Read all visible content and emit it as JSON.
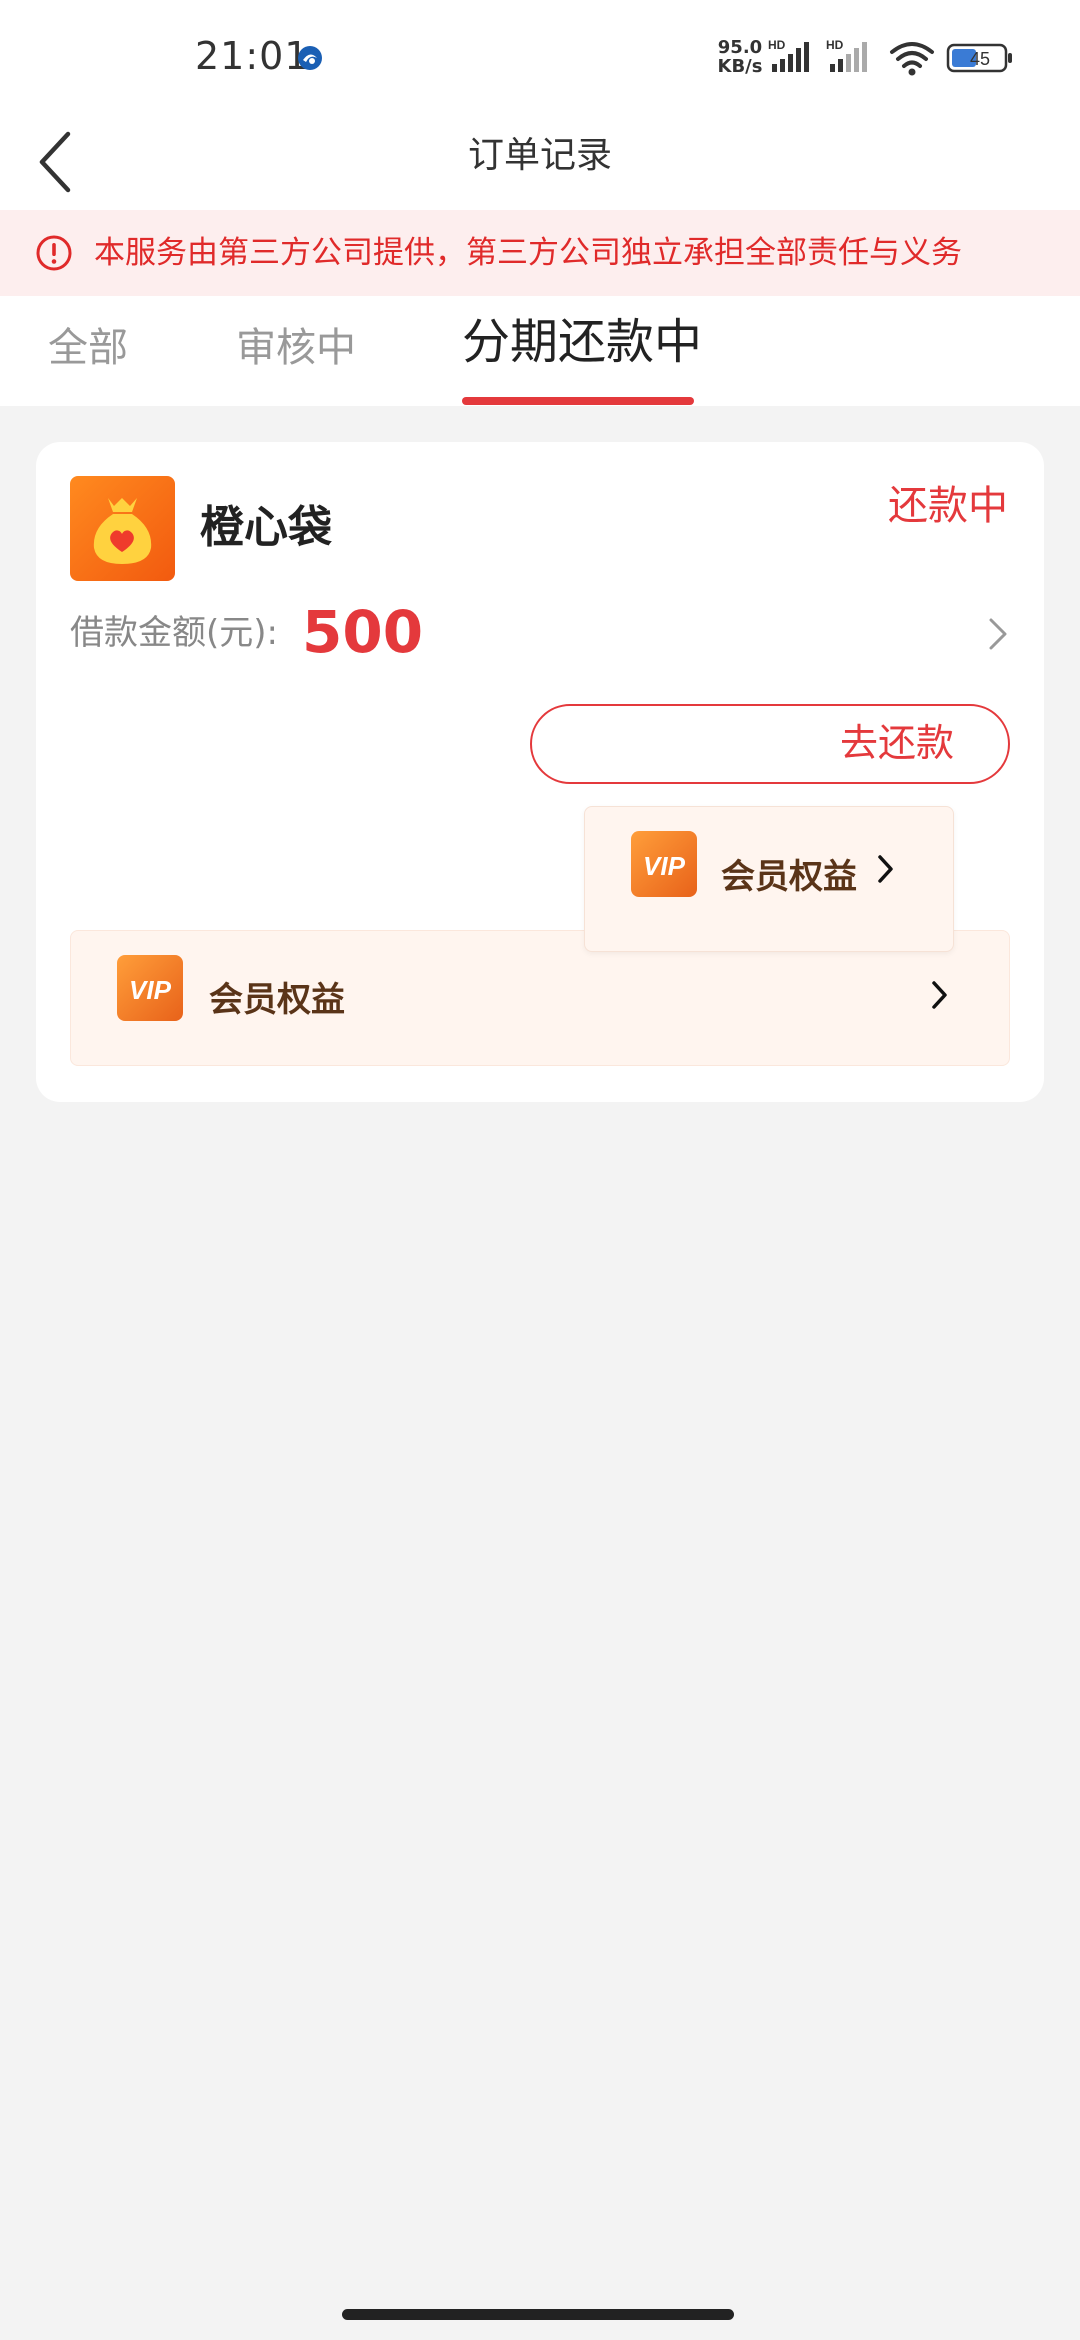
{
  "status_bar": {
    "time": "21:01",
    "net_speed_value": "95.0",
    "net_speed_unit": "KB/s",
    "sim1_label": "HD",
    "sim2_label": "HD",
    "battery": "45",
    "icons": [
      "app-notification-icon",
      "signal-icon",
      "signal-icon",
      "wifi-icon",
      "battery-icon"
    ]
  },
  "header": {
    "title": "订单记录",
    "back_icon": "chevron-left-icon"
  },
  "notice": {
    "text": "本服务由第三方公司提供，第三方公司独立承担全部责任与义务",
    "icon": "alert-circle-icon"
  },
  "tabs": [
    {
      "label": "全部",
      "active": false
    },
    {
      "label": "审核中",
      "active": false
    },
    {
      "label": "分期还款中",
      "active": true
    }
  ],
  "order": {
    "product_name": "橙心袋",
    "product_icon": "money-bag-heart-icon",
    "status": "还款中",
    "amount_label": "借款金额(元):",
    "amount": "500",
    "repay_button": "去还款",
    "member_popup_label": "会员权益",
    "member_row_label": "会员权益",
    "vip_badge": "VIP"
  },
  "colors": {
    "accent": "#e4393c",
    "notice_bg": "#fdeeee",
    "member_bg": "#fff5ef",
    "member_text": "#5a3418",
    "page_bg": "#f3f3f3"
  }
}
